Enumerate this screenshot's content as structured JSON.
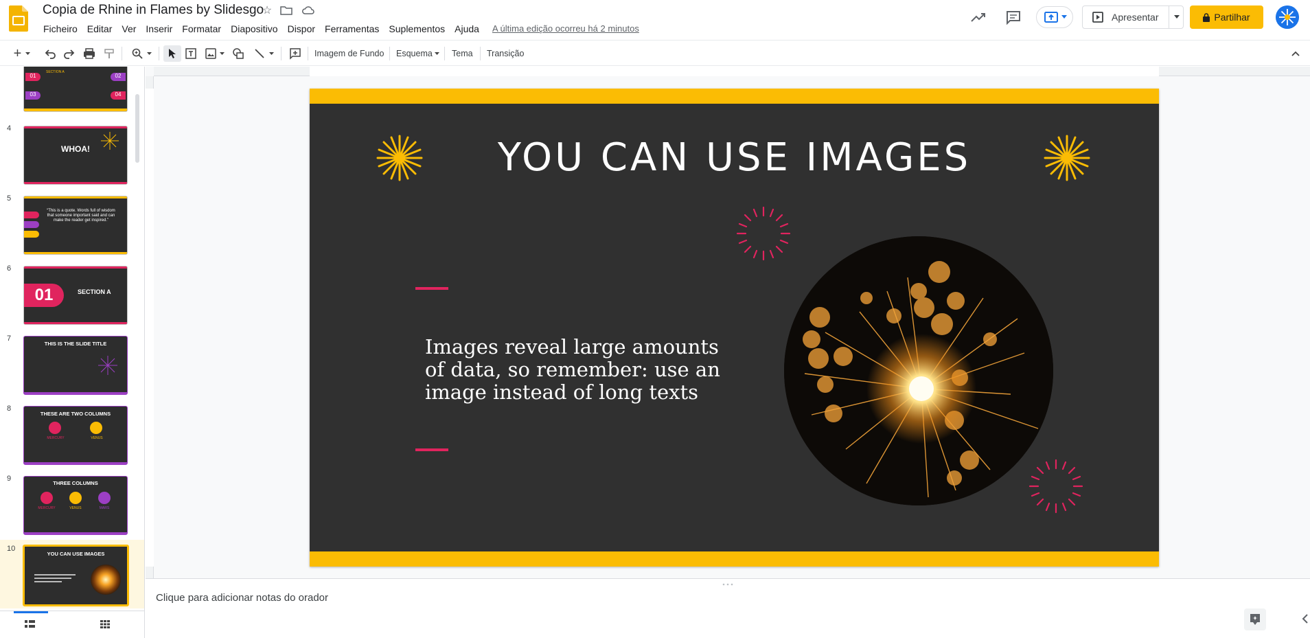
{
  "header": {
    "doc_title": "Copia de Rhine in Flames by Slidesgo",
    "menus": [
      "Ficheiro",
      "Editar",
      "Ver",
      "Inserir",
      "Formatar",
      "Diapositivo",
      "Dispor",
      "Ferramentas",
      "Suplementos",
      "Ajuda"
    ],
    "last_edit": "A última edição ocorreu há 2 minutos",
    "present_label": "Apresentar",
    "share_label": "Partilhar"
  },
  "toolbar": {
    "background_label": "Imagem de Fundo",
    "layout_label": "Esquema",
    "theme_label": "Tema",
    "transition_label": "Transição"
  },
  "filmstrip": {
    "slides": [
      {
        "num": "",
        "title": "SECTION A"
      },
      {
        "num": "4",
        "title": "WHOA!"
      },
      {
        "num": "5",
        "title": "“This is a quote. Words full of wisdom that someone important said and can make the reader get inspired.”"
      },
      {
        "num": "6",
        "title": "SECTION A",
        "big": "01"
      },
      {
        "num": "7",
        "title": "THIS IS THE SLIDE TITLE"
      },
      {
        "num": "8",
        "title": "THESE ARE TWO COLUMNS",
        "cols": [
          "MERCURY",
          "VENUS"
        ]
      },
      {
        "num": "9",
        "title": "THREE COLUMNS",
        "cols": [
          "MERCURY",
          "VENUS",
          "MARS"
        ]
      },
      {
        "num": "10",
        "title": "YOU CAN USE IMAGES"
      }
    ],
    "section_labels": [
      "01",
      "02",
      "03",
      "04"
    ]
  },
  "slide": {
    "title": "YOU CAN USE IMAGES",
    "body": "Images reveal large amounts of data, so remember: use an image instead of long texts"
  },
  "notes": {
    "placeholder": "Clique para adicionar notas do orador"
  },
  "colors": {
    "accent": "#fbbc04",
    "slide_bg": "#303030",
    "pink": "#e0245e",
    "purple": "#9c3fc4"
  }
}
